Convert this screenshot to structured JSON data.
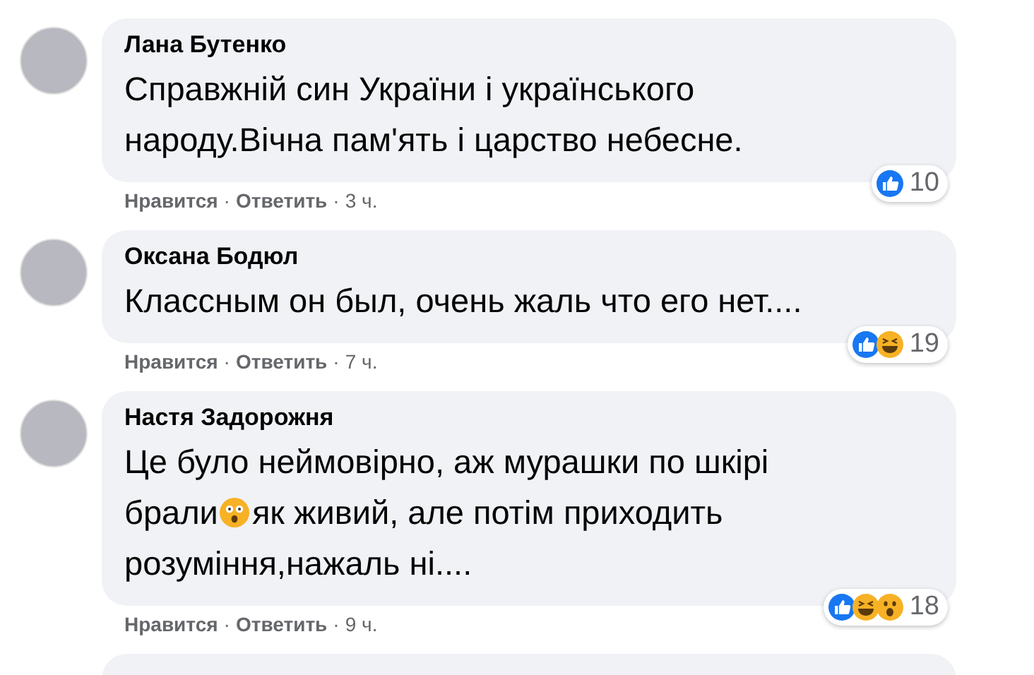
{
  "comments": [
    {
      "author": "Лана Бутенко",
      "lines": [
        [
          {
            "kind": "text",
            "text": "Справжній син України і українського"
          }
        ],
        [
          {
            "kind": "text",
            "text": "народу.Вічна пам'ять і царство небесне."
          }
        ]
      ],
      "reactions": [
        {
          "kind": "like"
        }
      ],
      "reaction_count": "10",
      "actions": [
        {
          "label": "Нравится",
          "separator": "·"
        },
        {
          "label": "Ответить",
          "separator": "·"
        }
      ],
      "time": "3 ч."
    },
    {
      "author": "Оксана Бодюл",
      "lines": [
        [
          {
            "kind": "text",
            "text": "Классным он был, очень жаль что его нет...."
          }
        ]
      ],
      "reactions": [
        {
          "kind": "like"
        },
        {
          "kind": "haha"
        }
      ],
      "reaction_count": "19",
      "actions": [
        {
          "label": "Нравится",
          "separator": "·"
        },
        {
          "label": "Ответить",
          "separator": "·"
        }
      ],
      "time": "7 ч."
    },
    {
      "author": "Настя Задорожня",
      "lines": [
        [
          {
            "kind": "text",
            "text": "Це було неймовірно, аж мурашки по шкірі"
          }
        ],
        [
          {
            "kind": "text",
            "text": "брали"
          },
          {
            "kind": "emoji"
          },
          {
            "kind": "text",
            "text": "як живий, але потім приходить"
          }
        ],
        [
          {
            "kind": "text",
            "text": "розуміння,нажаль ні...."
          }
        ]
      ],
      "reactions": [
        {
          "kind": "like"
        },
        {
          "kind": "haha"
        },
        {
          "kind": "wow"
        }
      ],
      "reaction_count": "18",
      "actions": [
        {
          "label": "Нравится",
          "separator": "·"
        },
        {
          "label": "Ответить",
          "separator": "·"
        }
      ],
      "time": "9 ч."
    }
  ]
}
